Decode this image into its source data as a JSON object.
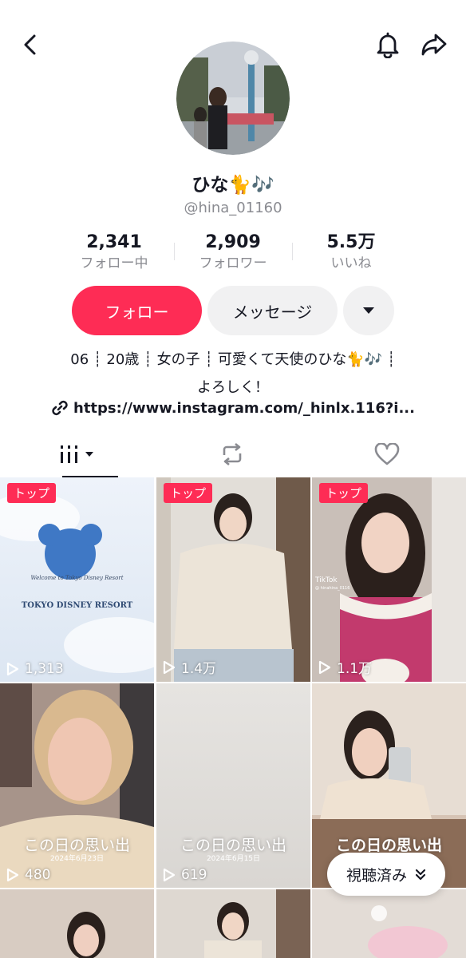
{
  "header": {
    "back_icon": "chevron-left-icon",
    "bell_icon": "bell-icon",
    "share_icon": "share-icon"
  },
  "profile": {
    "name": "ひな🐈🎶",
    "handle": "@hina_01160",
    "stats": [
      {
        "value": "2,341",
        "label": "フォロー中"
      },
      {
        "value": "2,909",
        "label": "フォロワー"
      },
      {
        "value": "5.5万",
        "label": "いいね"
      }
    ],
    "follow_label": "フォロー",
    "message_label": "メッセージ",
    "bio_line1": "06 ┊ 20歳 ┊ 女の子 ┊ 可愛くて天使のひな🐈🎶 ┊",
    "bio_line2": "よろしく！",
    "link": "https://www.instagram.com/_hinlx.116?i..."
  },
  "colors": {
    "accent": "#fe2c55",
    "secondary_bg": "#f1f1f2",
    "muted": "#8a8b91"
  },
  "videos": [
    {
      "badge": "トップ",
      "views": "1,313"
    },
    {
      "badge": "トップ",
      "views": "1.4万"
    },
    {
      "badge": "トップ",
      "views": "1.1万"
    },
    {
      "views": "480",
      "memory": "この日の思い出",
      "memory_date": "2024年6月23日"
    },
    {
      "views": "619",
      "memory": "この日の思い出",
      "memory_date": "2024年6月15日"
    },
    {
      "memory": "この日の思い出"
    }
  ],
  "tile1_text": {
    "welcome": "Welcome to Tokyo Disney Resort",
    "brand": "TOKYO DISNEY RESORT"
  },
  "tile3_text": {
    "watermark": "TikTok",
    "handle": "@ hinahina_0116"
  },
  "watched_label": "視聴済み"
}
